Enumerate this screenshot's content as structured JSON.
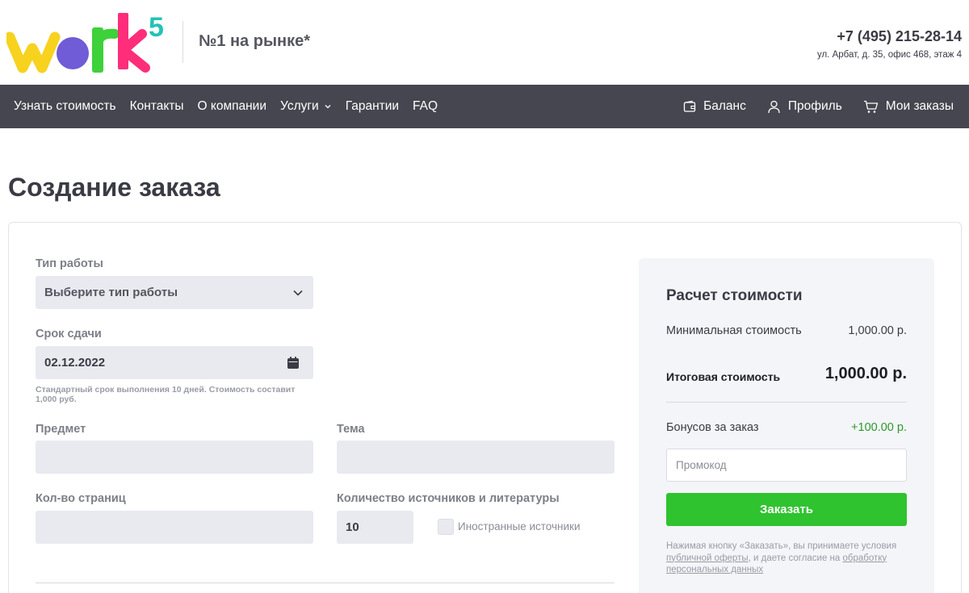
{
  "header": {
    "logo_text": "work5",
    "tagline": "№1 на рынке*",
    "phone": "+7 (495) 215-28-14",
    "address": "ул. Арбат, д. 35, офис 468, этаж 4"
  },
  "nav": {
    "items": [
      {
        "label": "Узнать стоимость"
      },
      {
        "label": "Контакты"
      },
      {
        "label": "О компании"
      },
      {
        "label": "Услуги",
        "has_dropdown": true
      },
      {
        "label": "Гарантии"
      },
      {
        "label": "FAQ"
      }
    ],
    "right": [
      {
        "label": "Баланс",
        "icon": "wallet-icon"
      },
      {
        "label": "Профиль",
        "icon": "user-icon"
      },
      {
        "label": "Мои заказы",
        "icon": "cart-icon"
      }
    ]
  },
  "page": {
    "title": "Создание заказа"
  },
  "form": {
    "work_type": {
      "label": "Тип работы",
      "value": "Выберите тип работы"
    },
    "deadline": {
      "label": "Срок сдачи",
      "value": "02.12.2022",
      "hint": "Стандартный срок выполнения 10 дней. Стоимость составит 1,000 руб."
    },
    "subject": {
      "label": "Предмет",
      "value": ""
    },
    "topic": {
      "label": "Тема",
      "value": ""
    },
    "pages": {
      "label": "Кол-во страниц",
      "value": ""
    },
    "sources": {
      "label": "Количество источников и литературы",
      "value": "10"
    },
    "foreign_sources": {
      "label": "Иностранные источники",
      "checked": false
    }
  },
  "summary": {
    "title": "Расчет стоимости",
    "min_label": "Минимальная стоимость",
    "min_value": "1,000.00 р.",
    "total_label": "Итоговая стоимость",
    "total_value": "1,000.00 р.",
    "bonus_label": "Бонусов за заказ",
    "bonus_value": "+100.00 р.",
    "promo_placeholder": "Промокод",
    "order_button": "Заказать",
    "legal_prefix": "Нажимая кнопку «Заказать», вы принимаете условия ",
    "legal_link1": "публичной оферты",
    "legal_middle": ", и даете согласие на ",
    "legal_link2": "обработку персональных данных"
  },
  "colors": {
    "nav_bg": "#45464f",
    "accent_green": "#2fc32f",
    "bonus_green": "#2b9a2b",
    "field_bg": "#e8eaf0",
    "logo_yellow": "#f7d21e",
    "logo_purple": "#6f5cd6",
    "logo_green": "#3dd13a",
    "logo_pink": "#ff2d7a",
    "logo_teal": "#22c3b5"
  }
}
